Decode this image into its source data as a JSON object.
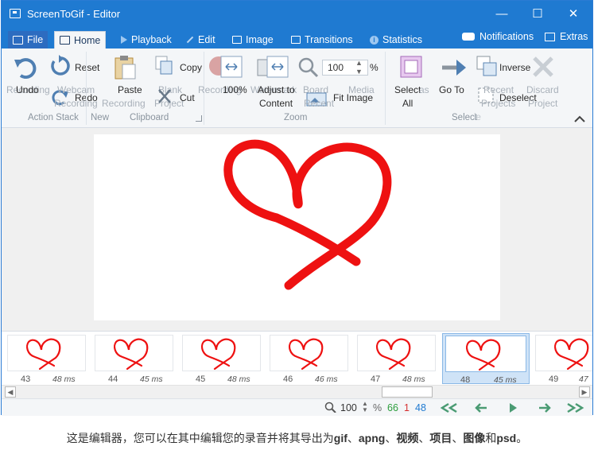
{
  "window": {
    "title": "ScreenToGif - Editor",
    "controls": {
      "minimize": "—",
      "maximize": "☐",
      "close": "✕"
    }
  },
  "tabs": [
    {
      "id": "file",
      "label": "File",
      "active": false
    },
    {
      "id": "home",
      "label": "Home",
      "active": true
    },
    {
      "id": "playback",
      "label": "Playback",
      "active": false
    },
    {
      "id": "edit",
      "label": "Edit",
      "active": false
    },
    {
      "id": "image",
      "label": "Image",
      "active": false
    },
    {
      "id": "transitions",
      "label": "Transitions",
      "active": false
    },
    {
      "id": "statistics",
      "label": "Statistics",
      "active": false
    }
  ],
  "tabs_right": {
    "notifications": "Notifications",
    "extras": "Extras"
  },
  "ribbon": {
    "action_stack": {
      "group": "Action Stack",
      "undo": "Undo",
      "reset": "Reset",
      "redo": "Redo",
      "ghost_recording": "Recording"
    },
    "new": {
      "group": "New",
      "webcam": "Webcam",
      "webcam_recording": "Recording",
      "board": "Board",
      "board_recording": "Recording",
      "blank": "Blank",
      "media": "Media",
      "project": "Project"
    },
    "clipboard": {
      "group": "Clipboard",
      "paste": "Paste",
      "copy": "Copy",
      "cut": "Cut"
    },
    "zoom": {
      "group": "Zoom",
      "recording": "Recording",
      "zoom_100": "100%",
      "adjust": "Adjust to",
      "adjust2": "Content",
      "fit": "Fit Image",
      "value": "100",
      "unit": "%",
      "ghost_watermark": "Watermark",
      "ghost_recent": "Recent"
    },
    "select": {
      "group": "Select",
      "select_all": "Select",
      "select_all2": "All",
      "go_to": "Go To",
      "inverse": "Inverse",
      "deselect": "Deselect",
      "recent": "Recent",
      "projects": "Projects",
      "discard": "Discard",
      "discard2": "Project",
      "ghost_as": "as",
      "ghost_le": "le"
    }
  },
  "frames": [
    {
      "number": "43",
      "delay": "48 ms",
      "selected": false
    },
    {
      "number": "44",
      "delay": "45 ms",
      "selected": false
    },
    {
      "number": "45",
      "delay": "48 ms",
      "selected": false
    },
    {
      "number": "46",
      "delay": "46 ms",
      "selected": false
    },
    {
      "number": "47",
      "delay": "48 ms",
      "selected": false
    },
    {
      "number": "48",
      "delay": "45 ms",
      "selected": true
    },
    {
      "number": "49",
      "delay": "47",
      "selected": false
    }
  ],
  "status": {
    "zoom": "100",
    "zoom_unit": "%",
    "total_frames": "66",
    "selected_count": "1",
    "current_frame": "48"
  },
  "caption": {
    "text_before": "这是编辑器，您可以在其中编辑您的录音并将其导出为",
    "formats": [
      "gif",
      "apng",
      "视频",
      "项目",
      "图像"
    ],
    "join": "和",
    "last": "psd",
    "end": "。"
  },
  "colors": {
    "accent": "#1f7ad1",
    "heart": "#ee1111",
    "count_total": "#2e9e3e",
    "count_selected": "#d63031",
    "count_current": "#1f7ad1",
    "nav_arrows": "#4a9b73"
  }
}
